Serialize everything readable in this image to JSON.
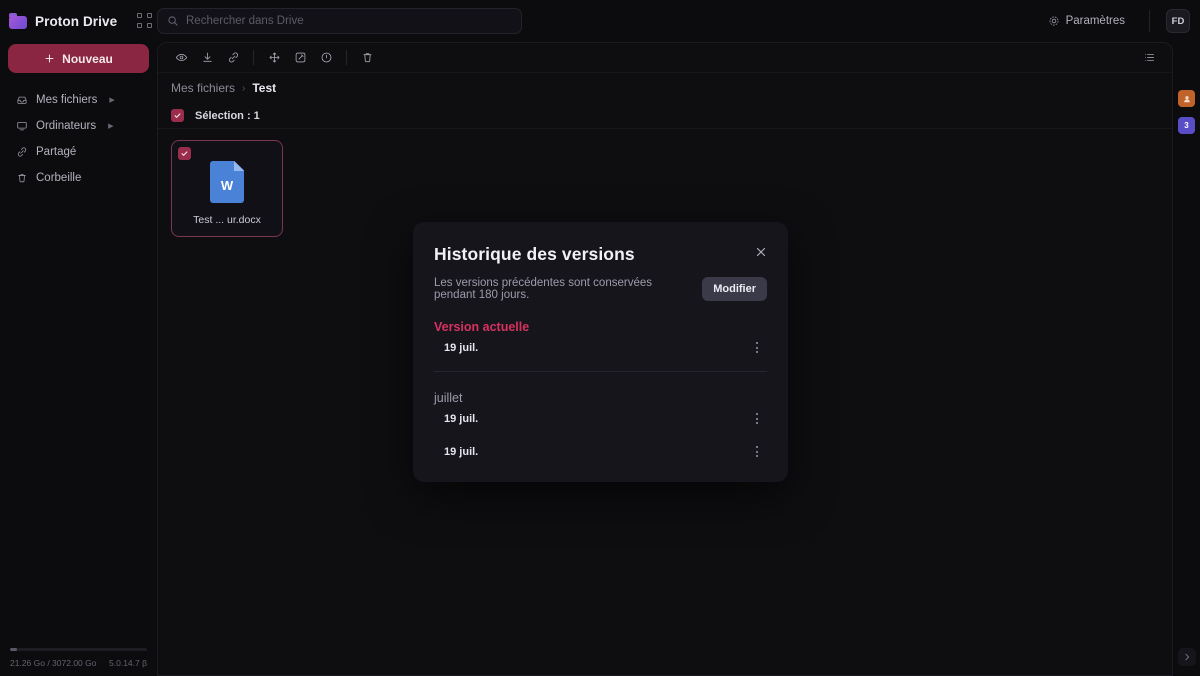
{
  "header": {
    "brand": "Proton Drive",
    "apps_grid_icon": "apps-grid-icon",
    "search": {
      "placeholder": "Rechercher dans Drive",
      "value": "",
      "icon": "search-icon"
    },
    "settings_label": "Paramètres",
    "settings_icon": "gear-icon",
    "avatar_initials": "FD"
  },
  "sidebar": {
    "new_button": "Nouveau",
    "new_button_color": "#8a2642",
    "items": [
      {
        "label": "Mes fichiers",
        "icon": "inbox-icon",
        "expandable": true
      },
      {
        "label": "Ordinateurs",
        "icon": "monitor-icon",
        "expandable": true
      },
      {
        "label": "Partagé",
        "icon": "link-icon",
        "expandable": false
      },
      {
        "label": "Corbeille",
        "icon": "trash-icon",
        "expandable": false
      }
    ],
    "storage": {
      "used_label": "21.26 Go / 3072.00 Go",
      "version_label": "5.0.14.7 β",
      "percent": 5
    }
  },
  "toolbar": {
    "buttons": [
      {
        "name": "preview-button",
        "icon": "eye-icon",
        "label": "Aperçu"
      },
      {
        "name": "download-button",
        "icon": "download-icon",
        "label": "Télécharger"
      },
      {
        "name": "share-link-button",
        "icon": "link-icon",
        "label": "Partager"
      },
      {
        "name": "move-button",
        "icon": "move-icon",
        "label": "Déplacer"
      },
      {
        "name": "rename-button",
        "icon": "edit-icon",
        "label": "Renommer"
      },
      {
        "name": "details-button",
        "icon": "info-icon",
        "label": "Détails"
      },
      {
        "name": "trash-button",
        "icon": "trash-icon",
        "label": "Corbeille"
      }
    ],
    "view_toggle_icon": "list-view-icon"
  },
  "breadcrumb": {
    "root": "Mes fichiers",
    "separator": "›",
    "current": "Test"
  },
  "selection": {
    "label": "Sélection : 1",
    "checked": true
  },
  "files": [
    {
      "name": "Test ... ur.docx",
      "type": "docx",
      "glyph": "W",
      "selected": true,
      "icon_color": "#4a82d8"
    }
  ],
  "rail": {
    "apps": [
      {
        "name": "contacts-app",
        "glyph": "",
        "color": "#c0632a"
      },
      {
        "name": "calendar-app",
        "glyph": "3",
        "color": "#5a4ec8"
      }
    ],
    "expand_icon": "chevron-right-icon"
  },
  "modal": {
    "title": "Historique des versions",
    "close_icon": "close-icon",
    "subtitle": "Les versions précédentes sont conservées pendant 180 jours.",
    "modify_button": "Modifier",
    "accent_color": "#d7315f",
    "sections": [
      {
        "title": "Version actuelle",
        "highlighted": true,
        "versions": [
          {
            "date": "19 juil.",
            "menu_icon": "kebab-menu-icon"
          }
        ]
      },
      {
        "title": "juillet",
        "highlighted": false,
        "versions": [
          {
            "date": "19 juil.",
            "menu_icon": "kebab-menu-icon"
          },
          {
            "date": "19 juil.",
            "menu_icon": "kebab-menu-icon"
          }
        ]
      }
    ]
  }
}
